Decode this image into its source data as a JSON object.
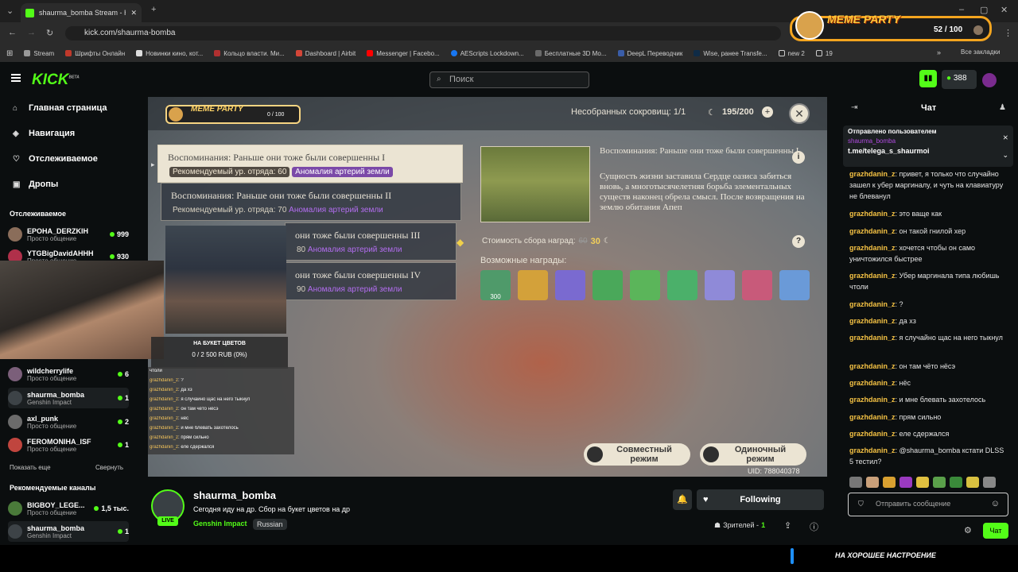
{
  "browser": {
    "tab_title": "shaurma_bomba Stream - К",
    "url": "kick.com/shaurma-bomba",
    "bookmarks": [
      "Stream",
      "Шрифты Онлайн",
      "Новинки кино, кот...",
      "Кольцо власти. Ми...",
      "Dashboard | Airbit",
      "Messenger | Facebo...",
      "AEScripts Lockdown...",
      "Бесплатные 3D Мо...",
      "DeepL Переводчик",
      "Wise, ранее Transfe...",
      "new 2",
      "19"
    ],
    "all_bookmarks": "Все закладки"
  },
  "meme_party": {
    "title": "MEME PARTY",
    "count": "52 / 100"
  },
  "kick": {
    "logo": "KICK",
    "logo_sup": "BETA",
    "search_placeholder": "Поиск",
    "points": "388"
  },
  "nav": [
    {
      "label": "Главная страница",
      "icon": "home-icon"
    },
    {
      "label": "Навигация",
      "icon": "compass-icon"
    },
    {
      "label": "Отслеживаемое",
      "icon": "heart-icon"
    },
    {
      "label": "Дропы",
      "icon": "gift-icon"
    }
  ],
  "following": {
    "title": "Отслеживаемое",
    "channels": [
      {
        "name": "EPOHA_DERZKIH",
        "category": "Просто общение",
        "viewers": "999",
        "color": "#8a6d5a"
      },
      {
        "name": "YTGBigDavidAHHH",
        "category": "Просто общение",
        "viewers": "930",
        "color": "#b0304a"
      },
      {
        "name": "wildcherrylife",
        "category": "Просто общение",
        "viewers": "6",
        "color": "#7b5f7a"
      },
      {
        "name": "shaurma_bomba",
        "category": "Genshin Impact",
        "viewers": "1",
        "color": "#3d4347"
      },
      {
        "name": "axl_punk",
        "category": "Просто общение",
        "viewers": "2",
        "color": "#6b6b6b"
      },
      {
        "name": "FEROMONIHA_ISF",
        "category": "Просто общение",
        "viewers": "1",
        "color": "#c0453e"
      }
    ],
    "show_more": "Показать еще",
    "collapse": "Свернуть"
  },
  "recommended": {
    "title": "Рекомендуемые каналы",
    "channels": [
      {
        "name": "BIGBOY_LEGE...",
        "category": "Просто общение",
        "viewers": "1,5 тыс.",
        "color": "#4a7a3a"
      },
      {
        "name": "shaurma_bomba",
        "category": "Genshin Impact",
        "viewers": "1",
        "color": "#3d4347"
      }
    ]
  },
  "video": {
    "meme_count": "0 / 100",
    "uncollected": "Несобранных сокровищ: 1/1",
    "resin": "195/200",
    "quests": [
      {
        "title": "Воспоминания: Раньше они тоже были совершенны I",
        "rec": "Рекомендуемый ур. отряда: 60",
        "anomaly": "Аномалия артерий земли"
      },
      {
        "title": "Воспоминания: Раньше они тоже были совершенны II",
        "rec": "Рекомендуемый ур. отряда: 70",
        "anomaly": "Аномалия артерий земли"
      },
      {
        "title": "они тоже были совершенны III",
        "rec": "80",
        "anomaly": "Аномалия артерий земли"
      },
      {
        "title": "они тоже были совершенны IV",
        "rec": "90",
        "anomaly": "Аномалия артерий земли"
      }
    ],
    "detail_title": "Воспоминания: Раньше они тоже были совершенны I",
    "detail_desc": "Сущность жизни заставила Сердце оазиса забиться вновь, а многотысячелетняя борьба элементальных существ наконец обрела смысл. После возвращения на землю обитания Апеп",
    "cost_label": "Стоимость сбора наград:",
    "cost_old": "60",
    "cost_new": "30",
    "rewards_label": "Возможные награды:",
    "reward_first_qty": "300",
    "reward_colors": [
      "#4f9a6a",
      "#d3a13a",
      "#7a6ad0",
      "#4aa85a",
      "#5bb55a",
      "#4bb06a",
      "#8f8ad8",
      "#c85a7a",
      "#6a9ad8"
    ],
    "coop_label": "Совместный режим",
    "solo_label": "Одиночный режим",
    "uid": "UID: 788040378",
    "donation_title": "НА БУКЕТ ЦВЕТОВ",
    "donation_progress": "0 / 2 500 RUB (0%)",
    "mini_chat_header": "чтоли",
    "mini_chat": [
      {
        "user": "grazhdanin_z",
        "text": "?"
      },
      {
        "user": "grazhdanin_z",
        "text": "да хз"
      },
      {
        "user": "grazhdanin_z",
        "text": "я случайно щас на него тыкнул"
      },
      {
        "user": "grazhdanin_z",
        "text": "он там чёто нёсэ"
      },
      {
        "user": "grazhdanin_z",
        "text": "нёс"
      },
      {
        "user": "grazhdanin_z",
        "text": "и мне блевать захотелось"
      },
      {
        "user": "grazhdanin_z",
        "text": "прям сильно"
      },
      {
        "user": "grazhdanin_z",
        "text": "еле сдержался"
      }
    ]
  },
  "stream": {
    "channel": "shaurma_bomba",
    "live": "LIVE",
    "title": "Сегодня иду на др. Сбор на букет цветов на др",
    "category": "Genshin Impact",
    "language": "Russian",
    "follow_label": "Following",
    "viewers_label": "Зрителей -",
    "viewers": "1"
  },
  "chat": {
    "title": "Чат",
    "pinned_by": "Отправлено пользователем",
    "pinned_user": "shaurma_bomba",
    "pinned_text": "t.me/telega_s_shaurmoi",
    "messages": [
      {
        "user": "grazhdanin_z",
        "text": "привет, я только что случайно зашел к убер маргиналу, и чуть на клавиатуру не блеванул"
      },
      {
        "user": "grazhdanin_z",
        "text": "это ваще как"
      },
      {
        "user": "grazhdanin_z",
        "text": "он такой гнилой хер"
      },
      {
        "user": "grazhdanin_z",
        "text": "хочется чтобы он само уничтожился быстрее"
      },
      {
        "user": "grazhdanin_z",
        "text": "Убер маргинала типа любишь чтоли"
      },
      {
        "user": "grazhdanin_z",
        "text": "?"
      },
      {
        "user": "grazhdanin_z",
        "text": "да хз"
      },
      {
        "user": "grazhdanin_z",
        "text": "я случайно щас на него тыкнул"
      },
      {
        "user": "grazhdanin_z",
        "text": "он там чёто нёсэ"
      },
      {
        "user": "grazhdanin_z",
        "text": "нёс"
      },
      {
        "user": "grazhdanin_z",
        "text": "и мне блевать захотелось"
      },
      {
        "user": "grazhdanin_z",
        "text": "прям сильно"
      },
      {
        "user": "grazhdanin_z",
        "text": "еле сдержался"
      },
      {
        "user": "grazhdanin_z",
        "text": "@shaurma_bomba кстати DLSS 5 тестил?"
      }
    ],
    "input_placeholder": "Отправить сообщение",
    "send_label": "Чат"
  },
  "overlay_bottom": "НА ХОРОШЕЕ НАСТРОЕНИЕ"
}
